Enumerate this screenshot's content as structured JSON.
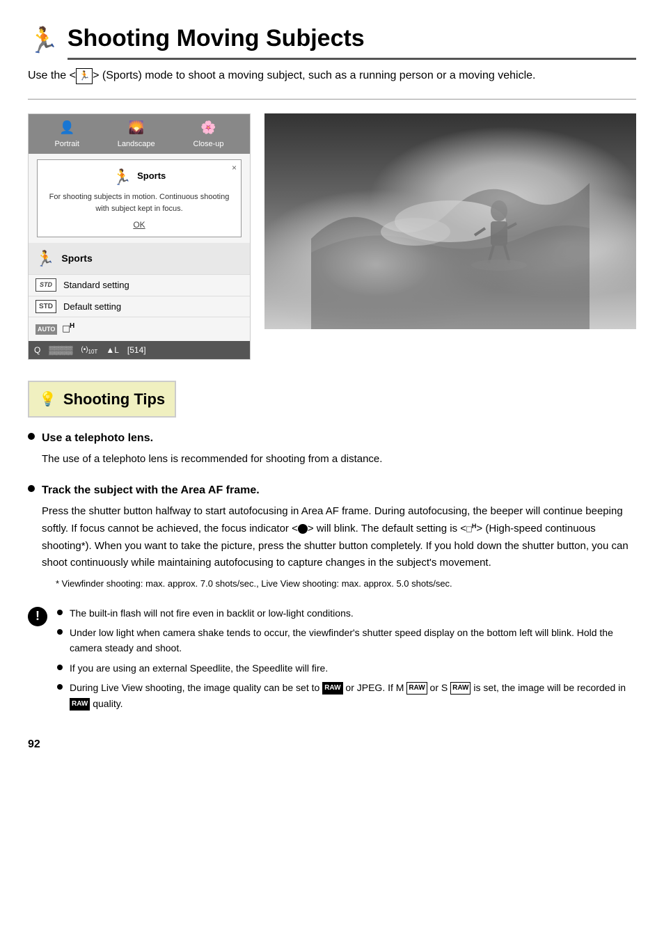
{
  "header": {
    "icon": "🏃",
    "title": "Shooting Moving Subjects"
  },
  "intro": {
    "text": "Use the <",
    "icon": "🏃",
    "text2": "> (Sports) mode to shoot a moving subject, such as a running person or a moving vehicle."
  },
  "camera_ui": {
    "modes": [
      {
        "label": "Portrait",
        "icon": "👤"
      },
      {
        "label": "Landscape",
        "icon": "🌄"
      },
      {
        "label": "Close-up",
        "icon": "🌸"
      }
    ],
    "tooltip": {
      "title": "Sports",
      "description": "For shooting subjects in motion. Continuous shooting with subject kept in focus.",
      "ok_label": "OK",
      "close": "×"
    },
    "sports_label": "Sports",
    "settings": [
      {
        "badge": "STD",
        "label": "Standard setting",
        "style": "italic"
      },
      {
        "badge": "STD",
        "label": "Default setting",
        "style": "box"
      }
    ],
    "auto_label": "AUTO",
    "drive_icon": "□H",
    "status": {
      "items": [
        "Q",
        "▒▒▒▒",
        "(•)",
        "▲L",
        "514"
      ]
    }
  },
  "shooting_tips": {
    "section_label": "Shooting Tips",
    "tips": [
      {
        "title": "Use a telephoto lens.",
        "body": "The use of a telephoto lens is recommended for shooting from a distance."
      },
      {
        "title": "Track the subject with the Area AF frame.",
        "body": "Press the shutter button halfway to start autofocusing in Area AF frame. During autofocusing, the beeper will continue beeping softly. If focus cannot be achieved, the focus indicator <●> will blink. The default setting is <□H> (High-speed continuous shooting*). When you want to take the picture, press the shutter button completely. If you hold down the shutter button, you can shoot continuously while maintaining autofocusing to capture changes in the subject's movement.",
        "note": "* Viewfinder shooting: max. approx. 7.0 shots/sec., Live View shooting: max. approx. 5.0 shots/sec."
      }
    ],
    "warnings": [
      "The built-in flash will not fire even in backlit or low-light conditions.",
      "Under low light when camera shake tends to occur, the viewfinder's shutter speed display on the bottom left will blink. Hold the camera steady and shoot.",
      "If you are using an external Speedlite, the Speedlite will fire.",
      "During Live View shooting, the image quality can be set to RAW or JPEG. If M RAW or S RAW is set, the image will be recorded in RAW quality."
    ]
  },
  "page_number": "92"
}
